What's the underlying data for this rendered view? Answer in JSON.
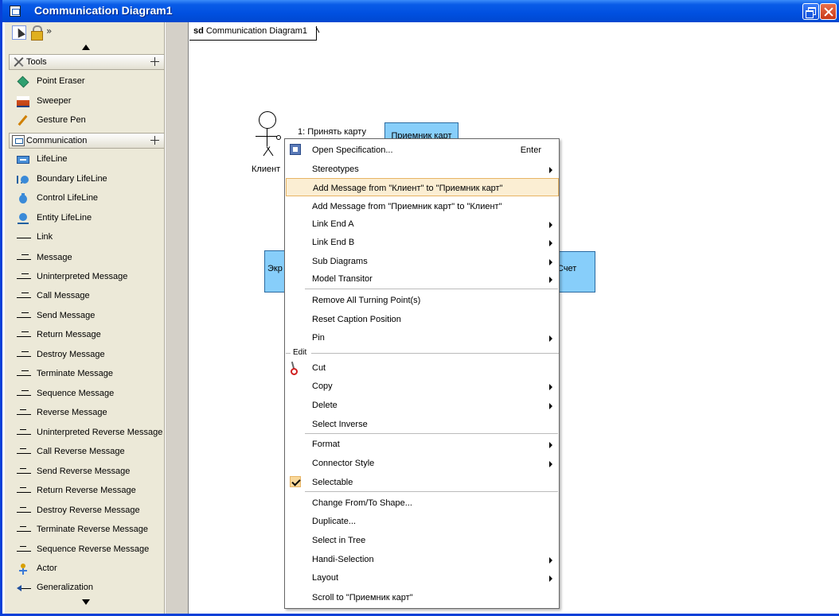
{
  "window": {
    "title": "Communication Diagram1"
  },
  "palette": {
    "sections": [
      {
        "label": "Tools",
        "icon": "tools-icon"
      },
      {
        "label": "Communication",
        "icon": "communication-icon"
      }
    ],
    "tools": [
      {
        "label": "Point Eraser",
        "icon": "eraser-icon"
      },
      {
        "label": "Sweeper",
        "icon": "sweeper-icon"
      },
      {
        "label": "Gesture Pen",
        "icon": "pen-icon"
      }
    ],
    "items": [
      {
        "label": "LifeLine",
        "icon": "lifeline-icon"
      },
      {
        "label": "Boundary LifeLine",
        "icon": "boundary-lifeline-icon"
      },
      {
        "label": "Control LifeLine",
        "icon": "control-lifeline-icon"
      },
      {
        "label": "Entity LifeLine",
        "icon": "entity-lifeline-icon"
      },
      {
        "label": "Link",
        "icon": "link-icon"
      },
      {
        "label": "Message",
        "icon": "message-icon"
      },
      {
        "label": "Uninterpreted Message",
        "icon": "message-icon"
      },
      {
        "label": "Call Message",
        "icon": "message-icon"
      },
      {
        "label": "Send Message",
        "icon": "message-icon"
      },
      {
        "label": "Return Message",
        "icon": "message-icon"
      },
      {
        "label": "Destroy Message",
        "icon": "message-icon"
      },
      {
        "label": "Terminate Message",
        "icon": "message-icon"
      },
      {
        "label": "Sequence Message",
        "icon": "message-icon"
      },
      {
        "label": "Reverse Message",
        "icon": "reverse-message-icon"
      },
      {
        "label": "Uninterpreted Reverse Message",
        "icon": "reverse-message-icon"
      },
      {
        "label": "Call Reverse Message",
        "icon": "reverse-message-icon"
      },
      {
        "label": "Send Reverse Message",
        "icon": "reverse-message-icon"
      },
      {
        "label": "Return Reverse Message",
        "icon": "reverse-message-icon"
      },
      {
        "label": "Destroy Reverse Message",
        "icon": "reverse-message-icon"
      },
      {
        "label": "Terminate Reverse Message",
        "icon": "reverse-message-icon"
      },
      {
        "label": "Sequence Reverse Message",
        "icon": "reverse-message-icon"
      },
      {
        "label": "Actor",
        "icon": "actor-icon"
      },
      {
        "label": "Generalization",
        "icon": "generalization-icon"
      }
    ]
  },
  "diagram": {
    "frame_keyword": "sd",
    "frame_name": "Communication Diagram1",
    "actor_name": "Клиент",
    "message_label": "1: Принять карту",
    "lifelines": {
      "receiver": "Приемник карт",
      "screen": "Экр",
      "account": "Счет"
    }
  },
  "context_menu": {
    "items": [
      {
        "label": "Open Specification...",
        "shortcut": "Enter",
        "icon": "specification-icon"
      },
      {
        "label": "Stereotypes",
        "submenu": true
      },
      {
        "label": "Add Message from \"Клиент\" to \"Приемник карт\"",
        "highlighted": true
      },
      {
        "label": "Add Message from \"Приемник карт\" to \"Клиент\""
      },
      {
        "label": "Link End A",
        "submenu": true
      },
      {
        "label": "Link End B",
        "submenu": true
      },
      {
        "label": "Sub Diagrams",
        "submenu": true
      },
      {
        "label": "Model Transitor",
        "submenu": true
      },
      {
        "label": "Remove All Turning Point(s)"
      },
      {
        "label": "Reset Caption Position"
      },
      {
        "label": "Pin",
        "submenu": true
      },
      {
        "label": "Cut",
        "icon": "scissors-icon"
      },
      {
        "label": "Copy",
        "submenu": true
      },
      {
        "label": "Delete",
        "submenu": true
      },
      {
        "label": "Select Inverse"
      },
      {
        "label": "Format",
        "submenu": true
      },
      {
        "label": "Connector Style",
        "submenu": true
      },
      {
        "label": "Selectable",
        "checked": true
      },
      {
        "label": "Change From/To Shape..."
      },
      {
        "label": "Duplicate..."
      },
      {
        "label": "Select in Tree"
      },
      {
        "label": "Handi-Selection",
        "submenu": true
      },
      {
        "label": "Layout",
        "submenu": true
      },
      {
        "label": "Scroll to \"Приемник карт\""
      }
    ],
    "edit_group_label": "Edit"
  },
  "colors": {
    "titlebar": "#0050e0",
    "lifeline_fill": "#87cefa",
    "menu_highlight": "#fbeed3",
    "palette_bg": "#ece9d8"
  }
}
